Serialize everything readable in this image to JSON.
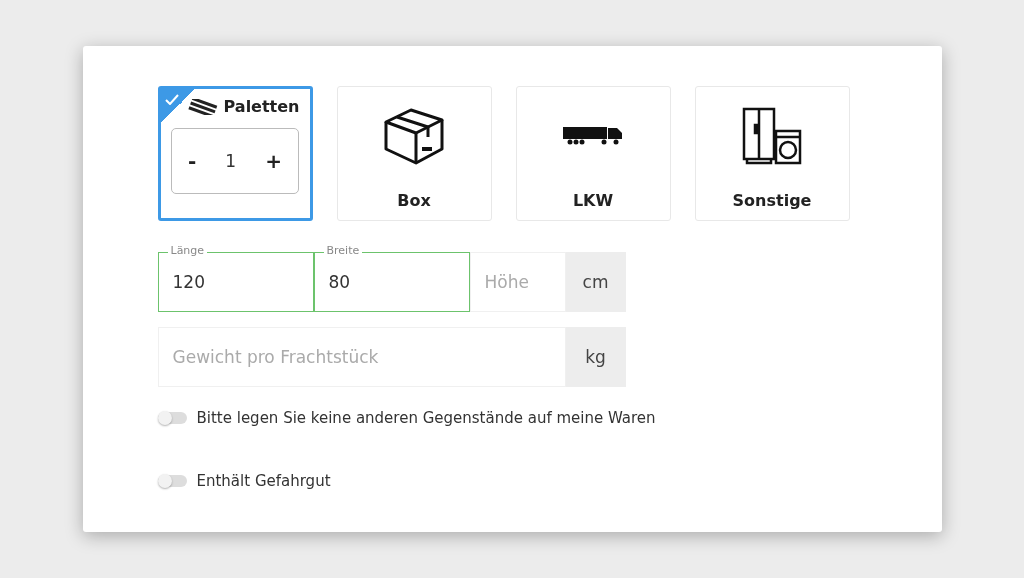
{
  "package_types": [
    {
      "kind": "pallet",
      "label": "Paletten",
      "selected": true,
      "quantity": {
        "minus": "-",
        "value": "1",
        "plus": "+"
      }
    },
    {
      "kind": "box",
      "label": "Box",
      "selected": false
    },
    {
      "kind": "truck",
      "label": "LKW",
      "selected": false
    },
    {
      "kind": "appliance",
      "label": "Sonstige",
      "selected": false
    }
  ],
  "dimensions": {
    "fields": [
      {
        "label": "Länge",
        "value": "120"
      },
      {
        "label": "Breite",
        "value": "80"
      },
      {
        "placeholder": "Höhe"
      }
    ],
    "unit": "cm"
  },
  "weight": {
    "placeholder": "Gewicht pro Frachtstück",
    "unit": "kg"
  },
  "toggles": [
    {
      "label": "Bitte legen Sie keine anderen Gegenstände auf meine Waren",
      "on": false
    },
    {
      "label": "Enthält Gefahrgut",
      "on": false
    }
  ]
}
